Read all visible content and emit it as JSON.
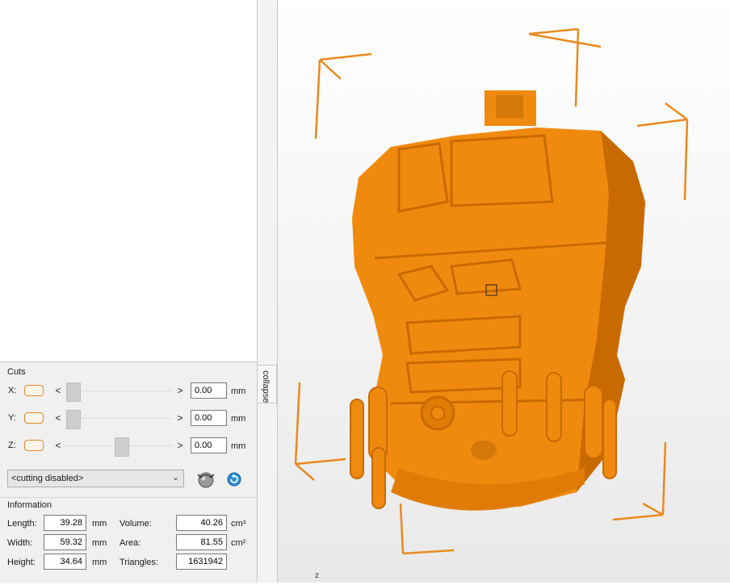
{
  "cuts": {
    "title": "Cuts",
    "axes": [
      {
        "label": "X:",
        "value": "0.00",
        "unit": "mm",
        "slider_pos": 0.1
      },
      {
        "label": "Y:",
        "value": "0.00",
        "unit": "mm",
        "slider_pos": 0.1
      },
      {
        "label": "Z:",
        "value": "0.00",
        "unit": "mm",
        "slider_pos": 0.6
      }
    ],
    "mode_select": "<cutting disabled>",
    "left_arrow": "<",
    "right_arrow": ">"
  },
  "information": {
    "title": "Information",
    "length": {
      "label": "Length:",
      "value": "39.28",
      "unit": "mm"
    },
    "width": {
      "label": "Width:",
      "value": "59.32",
      "unit": "mm"
    },
    "height": {
      "label": "Height:",
      "value": "34.64",
      "unit": "mm"
    },
    "volume": {
      "label": "Volume:",
      "value": "40.26",
      "unit": "cm³"
    },
    "area": {
      "label": "Area:",
      "value": "81.55",
      "unit": "cm²"
    },
    "triangles": {
      "label": "Triangles:",
      "value": "1631942"
    }
  },
  "collapse_label": "collapse",
  "axis_indicator": "z",
  "colors": {
    "model": "#f08a0e",
    "model_shadow": "#c96a00",
    "bbox": "#e8891f",
    "accent": "#e08a2e"
  },
  "icons": {
    "cut-tool": "cut-tool-icon",
    "reset": "reset-icon",
    "dropdown": "chevron-down-icon"
  }
}
